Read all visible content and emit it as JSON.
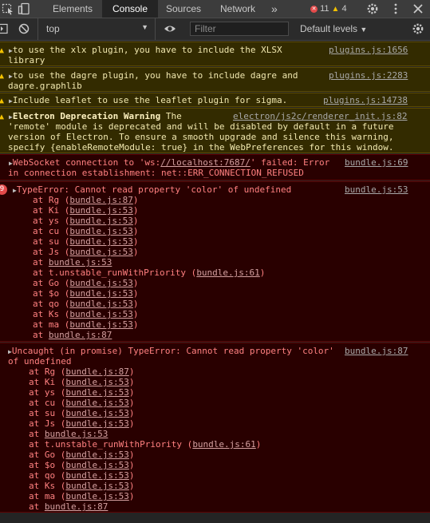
{
  "tabs": [
    "Elements",
    "Console",
    "Sources",
    "Network"
  ],
  "more_tabs": "»",
  "error_count": "11",
  "warning_count": "4",
  "context": "top",
  "filter_placeholder": "Filter",
  "levels": "Default levels",
  "messages": {
    "m1": {
      "l1": "to use the xlx plugin, you have to include the XLSX",
      "l2": "library",
      "src": "plugins.js:1656"
    },
    "m2": {
      "l1": "to use the dagre plugin, you have to include dagre and",
      "l2": "dagre.graphlib",
      "src": "plugins.js:2283"
    },
    "m3": {
      "l1": "Include leaflet to use the leaflet plugin for sigma.",
      "src": "plugins.js:14738"
    },
    "m4": {
      "title": "Electron Deprecation Warning",
      "t1rest": " The",
      "l2": "'remote' module is deprecated and will be disabled by default in a future",
      "l3": "version of Electron. To ensure a smooth upgrade and silence this warning,",
      "l4": "specify {enableRemoteModule: true} in the WebPreferences for this window.",
      "src": "electron/js2c/renderer_init.js:82"
    },
    "m5": {
      "pre": "WebSocket connection to 'ws:",
      "url": "//localhost:7687/",
      "post": "' failed: Error",
      "l2": "in connection establishment: net::ERR_CONNECTION_REFUSED",
      "src": "bundle.js:69"
    },
    "m6": {
      "count": "9",
      "l1": "TypeError: Cannot read property 'color' of undefined",
      "src": "bundle.js:53",
      "stack": [
        {
          "fn": "at Rg (",
          "ref": "bundle.js:87",
          "end": ")"
        },
        {
          "fn": "at Ki (",
          "ref": "bundle.js:53",
          "end": ")"
        },
        {
          "fn": "at ys (",
          "ref": "bundle.js:53",
          "end": ")"
        },
        {
          "fn": "at cu (",
          "ref": "bundle.js:53",
          "end": ")"
        },
        {
          "fn": "at su (",
          "ref": "bundle.js:53",
          "end": ")"
        },
        {
          "fn": "at Js (",
          "ref": "bundle.js:53",
          "end": ")"
        },
        {
          "fn": "at ",
          "ref": "bundle.js:53",
          "end": ""
        },
        {
          "fn": "at t.unstable_runWithPriority (",
          "ref": "bundle.js:61",
          "end": ")"
        },
        {
          "fn": "at Go (",
          "ref": "bundle.js:53",
          "end": ")"
        },
        {
          "fn": "at $o (",
          "ref": "bundle.js:53",
          "end": ")"
        },
        {
          "fn": "at qo (",
          "ref": "bundle.js:53",
          "end": ")"
        },
        {
          "fn": "at Ks (",
          "ref": "bundle.js:53",
          "end": ")"
        },
        {
          "fn": "at ma (",
          "ref": "bundle.js:53",
          "end": ")"
        },
        {
          "fn": "at ",
          "ref": "bundle.js:87",
          "end": ""
        }
      ]
    },
    "m7": {
      "l1": "Uncaught (in promise) TypeError: Cannot read property 'color'",
      "l2": "of undefined",
      "src": "bundle.js:87",
      "stack": [
        {
          "fn": "at Rg (",
          "ref": "bundle.js:87",
          "end": ")"
        },
        {
          "fn": "at Ki (",
          "ref": "bundle.js:53",
          "end": ")"
        },
        {
          "fn": "at ys (",
          "ref": "bundle.js:53",
          "end": ")"
        },
        {
          "fn": "at cu (",
          "ref": "bundle.js:53",
          "end": ")"
        },
        {
          "fn": "at su (",
          "ref": "bundle.js:53",
          "end": ")"
        },
        {
          "fn": "at Js (",
          "ref": "bundle.js:53",
          "end": ")"
        },
        {
          "fn": "at ",
          "ref": "bundle.js:53",
          "end": ""
        },
        {
          "fn": "at t.unstable_runWithPriority (",
          "ref": "bundle.js:61",
          "end": ")"
        },
        {
          "fn": "at Go (",
          "ref": "bundle.js:53",
          "end": ")"
        },
        {
          "fn": "at $o (",
          "ref": "bundle.js:53",
          "end": ")"
        },
        {
          "fn": "at qo (",
          "ref": "bundle.js:53",
          "end": ")"
        },
        {
          "fn": "at Ks (",
          "ref": "bundle.js:53",
          "end": ")"
        },
        {
          "fn": "at ma (",
          "ref": "bundle.js:53",
          "end": ")"
        },
        {
          "fn": "at ",
          "ref": "bundle.js:87",
          "end": ""
        }
      ]
    }
  },
  "icons": {
    "inspect": "inspect-element-icon",
    "device": "device-toolbar-icon",
    "settings": "gear-icon",
    "menu": "kebab-menu-icon",
    "close": "close-icon",
    "sidebar": "sidebar-toggle-icon",
    "clear": "clear-console-icon",
    "eye": "live-expression-eye-icon"
  },
  "colors": {
    "warning_bg": "#332b00",
    "error_bg": "#290000",
    "error_text": "#ff8080",
    "warning_icon": "#f2c100",
    "error_badge": "#e34a4a"
  }
}
